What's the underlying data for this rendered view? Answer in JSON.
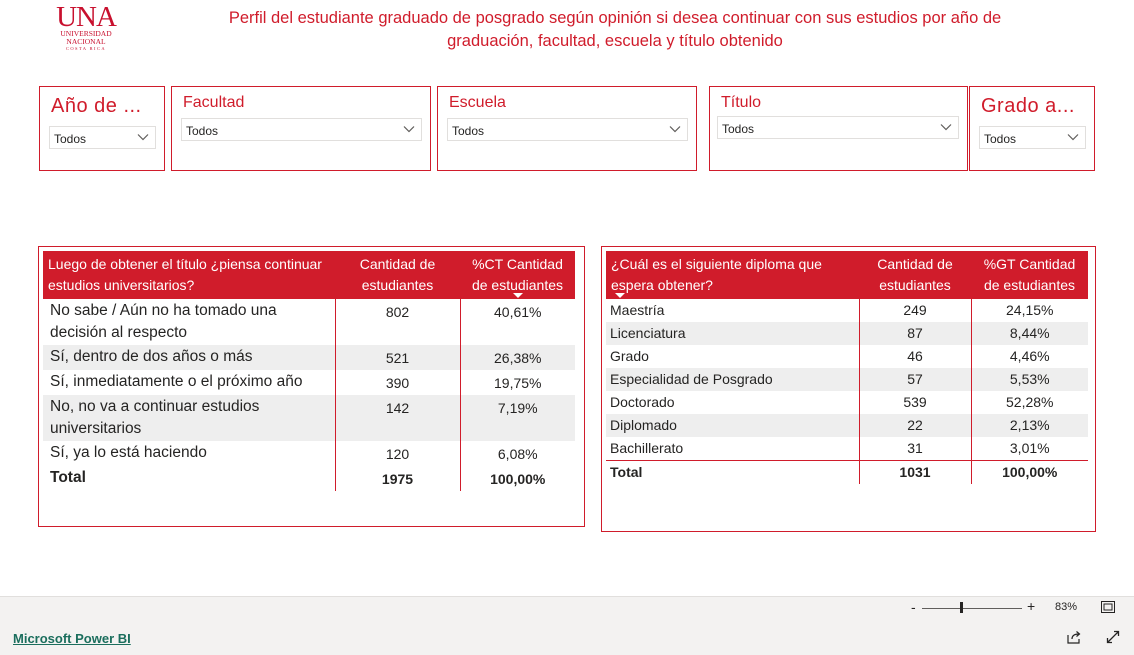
{
  "logo": {
    "main": "UNA",
    "line1": "UNIVERSIDAD",
    "line2": "NACIONAL",
    "line3": "COSTA RICA"
  },
  "report_title": "Perfil del estudiante graduado de posgrado según opinión si desea continuar con sus estudios por año de graduación, facultad, escuela y título obtenido",
  "slicers": [
    {
      "label": "Año de ...",
      "value": "Todos"
    },
    {
      "label": "Facultad",
      "value": "Todos"
    },
    {
      "label": "Escuela",
      "value": "Todos"
    },
    {
      "label": "Título",
      "value": "Todos"
    },
    {
      "label": "Grado a...",
      "value": "Todos"
    }
  ],
  "table1": {
    "headers": [
      "Luego de obtener el título ¿piensa continuar estudios universitarios?",
      "Cantidad de estudiantes",
      "%CT Cantidad de estudiantes"
    ],
    "rows": [
      {
        "label": "No sabe / Aún no ha tomado una decisión al respecto",
        "count": "802",
        "pct": "40,61%"
      },
      {
        "label": "Sí, dentro de dos años o más",
        "count": "521",
        "pct": "26,38%"
      },
      {
        "label": "Sí, inmediatamente o el próximo año",
        "count": "390",
        "pct": "19,75%"
      },
      {
        "label": "No, no va a continuar estudios universitarios",
        "count": "142",
        "pct": "7,19%"
      },
      {
        "label": "Sí, ya lo está haciendo",
        "count": "120",
        "pct": "6,08%"
      }
    ],
    "total": {
      "label": "Total",
      "count": "1975",
      "pct": "100,00%"
    }
  },
  "table2": {
    "headers": [
      "¿Cuál es el siguiente diploma que espera obtener?",
      "Cantidad de estudiantes",
      "%GT Cantidad de estudiantes"
    ],
    "rows": [
      {
        "label": "Maestría",
        "count": "249",
        "pct": "24,15%"
      },
      {
        "label": "Licenciatura",
        "count": "87",
        "pct": "8,44%"
      },
      {
        "label": "Grado",
        "count": "46",
        "pct": "4,46%"
      },
      {
        "label": "Especialidad de Posgrado",
        "count": "57",
        "pct": "5,53%"
      },
      {
        "label": "Doctorado",
        "count": "539",
        "pct": "52,28%"
      },
      {
        "label": "Diplomado",
        "count": "22",
        "pct": "2,13%"
      },
      {
        "label": "Bachillerato",
        "count": "31",
        "pct": "3,01%"
      }
    ],
    "total": {
      "label": "Total",
      "count": "1031",
      "pct": "100,00%"
    }
  },
  "footer": {
    "zoom_minus": "-",
    "zoom_plus": "+",
    "zoom_level": "83%",
    "powerbi_link": "Microsoft Power BI"
  },
  "colors": {
    "accent": "#d01c2b",
    "row_alt": "#eeeeee"
  },
  "icons": [
    "chevron-down-icon",
    "fit-page-icon",
    "share-icon",
    "expand-icon"
  ]
}
